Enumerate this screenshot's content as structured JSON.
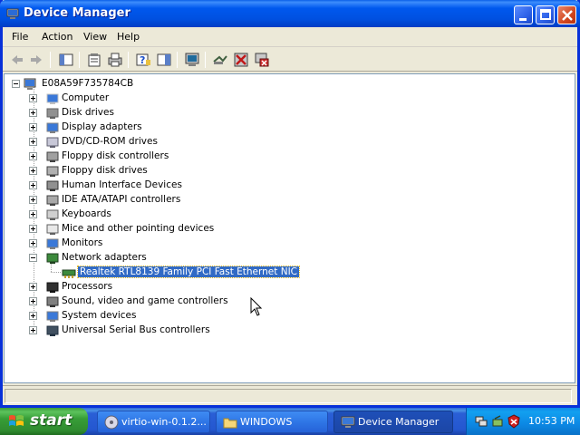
{
  "window": {
    "title": "Device Manager",
    "icon": "device-manager-icon"
  },
  "menu": {
    "items": [
      "File",
      "Action",
      "View",
      "Help"
    ]
  },
  "toolbar": {
    "buttons": [
      "back-icon",
      "forward-icon",
      "show-hide-tree-icon",
      "properties-icon",
      "print-icon",
      "help-icon",
      "show-hide-action-pane-icon",
      "update-driver-icon",
      "scan-hardware-icon",
      "disable-icon",
      "uninstall-icon"
    ]
  },
  "tree": {
    "root": "E08A59F735784CB",
    "categories": [
      {
        "label": "Computer",
        "icon": "computer-icon",
        "expanded": false
      },
      {
        "label": "Disk drives",
        "icon": "disk-drive-icon",
        "expanded": false
      },
      {
        "label": "Display adapters",
        "icon": "display-adapter-icon",
        "expanded": false
      },
      {
        "label": "DVD/CD-ROM drives",
        "icon": "cdrom-icon",
        "expanded": false
      },
      {
        "label": "Floppy disk controllers",
        "icon": "floppy-controller-icon",
        "expanded": false
      },
      {
        "label": "Floppy disk drives",
        "icon": "floppy-drive-icon",
        "expanded": false
      },
      {
        "label": "Human Interface Devices",
        "icon": "hid-icon",
        "expanded": false
      },
      {
        "label": "IDE ATA/ATAPI controllers",
        "icon": "ide-controller-icon",
        "expanded": false
      },
      {
        "label": "Keyboards",
        "icon": "keyboard-icon",
        "expanded": false
      },
      {
        "label": "Mice and other pointing devices",
        "icon": "mouse-icon",
        "expanded": false
      },
      {
        "label": "Monitors",
        "icon": "monitor-icon",
        "expanded": false
      },
      {
        "label": "Network adapters",
        "icon": "network-adapter-icon",
        "expanded": true,
        "children": [
          {
            "label": "Realtek RTL8139 Family PCI Fast Ethernet NIC",
            "icon": "network-card-icon",
            "selected": true
          }
        ]
      },
      {
        "label": "Processors",
        "icon": "processor-icon",
        "expanded": false
      },
      {
        "label": "Sound, video and game controllers",
        "icon": "sound-icon",
        "expanded": false
      },
      {
        "label": "System devices",
        "icon": "system-device-icon",
        "expanded": false
      },
      {
        "label": "Universal Serial Bus controllers",
        "icon": "usb-icon",
        "expanded": false
      }
    ]
  },
  "taskbar": {
    "start_label": "start",
    "tasks": [
      {
        "label": "virtio-win-0.1.2...",
        "icon": "cd-drive-icon",
        "active": false
      },
      {
        "label": "WINDOWS",
        "icon": "folder-icon",
        "active": false
      },
      {
        "label": "Device Manager",
        "icon": "device-manager-icon",
        "active": true
      }
    ],
    "tray_icons": [
      "network-tray-icon",
      "safely-remove-tray-icon",
      "security-shield-tray-icon"
    ],
    "clock": "10:53 PM"
  },
  "colors": {
    "titlebar": "#0058ee",
    "selection": "#316ac5",
    "taskbar": "#2457d0",
    "start_button": "#379d37",
    "window_face": "#ece9d8"
  }
}
